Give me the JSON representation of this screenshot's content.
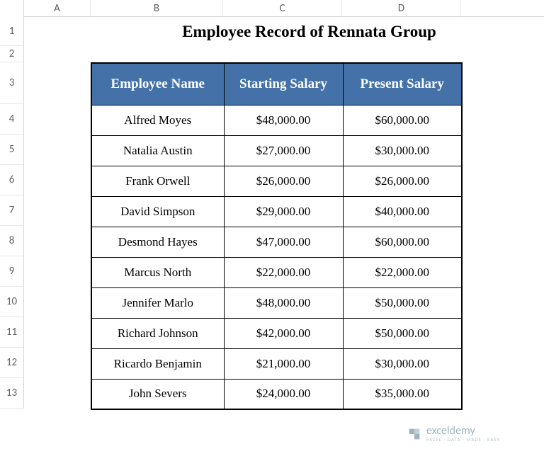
{
  "columns": [
    "A",
    "B",
    "C",
    "D"
  ],
  "rows": [
    "1",
    "2",
    "3",
    "4",
    "5",
    "6",
    "7",
    "8",
    "9",
    "10",
    "11",
    "12",
    "13"
  ],
  "title": "Employee Record of Rennata Group",
  "headers": {
    "name": "Employee Name",
    "starting": "Starting Salary",
    "present": "Present Salary"
  },
  "employees": [
    {
      "name": "Alfred Moyes",
      "starting": "$48,000.00",
      "present": "$60,000.00"
    },
    {
      "name": "Natalia Austin",
      "starting": "$27,000.00",
      "present": "$30,000.00"
    },
    {
      "name": "Frank Orwell",
      "starting": "$26,000.00",
      "present": "$26,000.00"
    },
    {
      "name": "David Simpson",
      "starting": "$29,000.00",
      "present": "$40,000.00"
    },
    {
      "name": "Desmond Hayes",
      "starting": "$47,000.00",
      "present": "$60,000.00"
    },
    {
      "name": "Marcus North",
      "starting": "$22,000.00",
      "present": "$22,000.00"
    },
    {
      "name": "Jennifer Marlo",
      "starting": "$48,000.00",
      "present": "$50,000.00"
    },
    {
      "name": "Richard Johnson",
      "starting": "$42,000.00",
      "present": "$50,000.00"
    },
    {
      "name": "Ricardo Benjamin",
      "starting": "$21,000.00",
      "present": "$30,000.00"
    },
    {
      "name": "John Severs",
      "starting": "$24,000.00",
      "present": "$35,000.00"
    }
  ],
  "watermark": {
    "brand": "exceldemy",
    "tag": "EXCEL · DATA · MADE · EASY"
  }
}
